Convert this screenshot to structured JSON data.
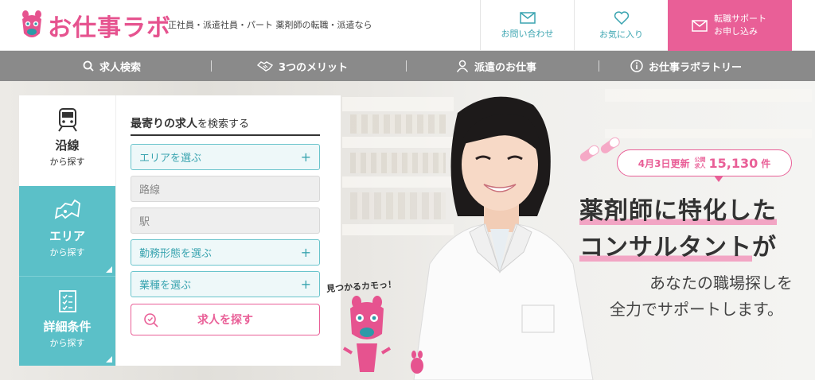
{
  "header": {
    "logo_text": "お仕事ラボ",
    "tagline": "正社員・派遣社員・パート 薬剤師の転職・派遣なら",
    "contact_label": "お問い合わせ",
    "favorite_label": "お気に入り",
    "support_line1": "転職サポート",
    "support_line2": "お申し込み"
  },
  "nav": {
    "items": [
      {
        "label": "求人検索",
        "icon": "search-icon"
      },
      {
        "label": "3つのメリット",
        "icon": "handshake-icon"
      },
      {
        "label": "派遣のお仕事",
        "icon": "person-icon"
      },
      {
        "label": "お仕事ラボラトリー",
        "icon": "info-icon"
      }
    ]
  },
  "search_panel": {
    "tabs": [
      {
        "main": "沿線",
        "sub": "から探す",
        "icon": "train-icon"
      },
      {
        "main": "エリア",
        "sub": "から探す",
        "icon": "map-icon"
      },
      {
        "main": "詳細条件",
        "sub": "から探す",
        "icon": "checklist-icon"
      }
    ],
    "title_bold": "最寄りの求人",
    "title_rest": "を検索する",
    "fields": {
      "area": "エリアを選ぶ",
      "line": "路線",
      "station": "駅",
      "employment": "勤務形態を選ぶ",
      "industry": "業種を選ぶ"
    },
    "search_button": "求人を探す"
  },
  "mascot": {
    "speech": "見つかるカモっ！"
  },
  "badge": {
    "update": "4月3日更新",
    "public_line1": "公開",
    "public_line2": "求人",
    "count": "15,130",
    "unit": "件"
  },
  "headline": {
    "line1": "薬剤師に特化した",
    "line2_hl": "コンサルタント",
    "line2_rest": "が",
    "sub1": "あなたの職場探しを",
    "sub2": "全力でサポートします。"
  },
  "colors": {
    "pink": "#e95f97",
    "teal": "#5bc0c8",
    "nav_gray": "#8a8a8a"
  }
}
